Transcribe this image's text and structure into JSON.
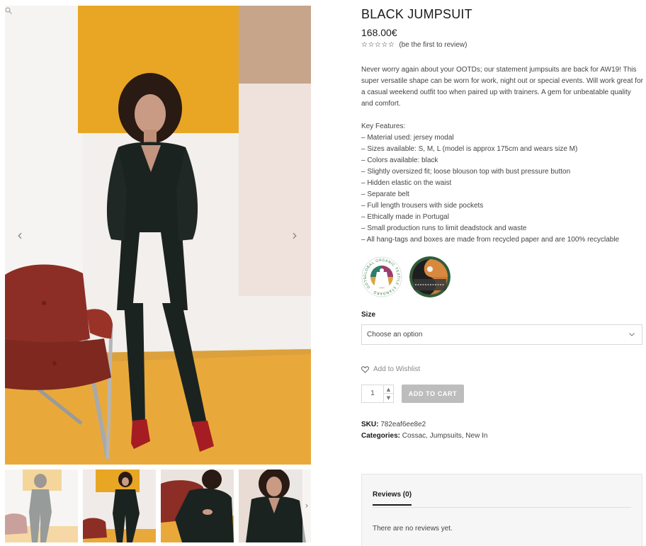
{
  "product": {
    "title": "BLACK JUMPSUIT",
    "price": "168.00€",
    "rating_stars": "☆☆☆☆☆",
    "review_link": "(be the first to review)",
    "description": "Never worry again about your OOTDs; our statement jumpsuits are back for AW19! This super versatile shape can be worn for work, night out or special events. Will work great for a casual weekend outfit too when paired up with trainers. A gem for unbeatable quality and comfort.",
    "features_heading": "Key Features:",
    "features": [
      "– Material used: jersey modal",
      "– Sizes available: S, M, L (model is approx 175cm and wears size M)",
      "– Colors available: black",
      "– Slightly oversized fit; loose blouson top with bust pressure button",
      "– Hidden elastic on the waist",
      "– Separate belt",
      "– Full length trousers with side pockets",
      "– Ethically made in Portugal",
      "– Small production runs to limit deadstock and waste",
      "– All hang-tags and boxes are made from recycled paper and are 100% recyclable"
    ]
  },
  "gallery": {
    "prev_icon": "chevron-left-icon",
    "next_icon": "chevron-right-icon",
    "prev_glyph": "‹",
    "next_glyph": "›",
    "thumb_next_glyph": "›",
    "thumbnail_count": 4,
    "active_thumbnail": 1
  },
  "badges": {
    "gots_text": "GLOBAL ORGANIC TEXTILE STANDARD · GOTS ·"
  },
  "form": {
    "size_label": "Size",
    "size_placeholder": "Choose an option",
    "wishlist_label": "Add to Wishlist",
    "quantity": "1",
    "qty_up_glyph": "▲",
    "qty_down_glyph": "▼",
    "add_to_cart": "ADD TO CART"
  },
  "meta": {
    "sku_label": "SKU:",
    "sku_value": "782eaf6ee8e2",
    "categories_label": "Categories:",
    "categories": [
      "Cossac",
      "Jumpsuits",
      "New In"
    ],
    "separator": ", "
  },
  "reviews": {
    "tab_label": "Reviews (0)",
    "empty_text": "There are no reviews yet."
  },
  "colors": {
    "mustard": "#e8a624",
    "floor": "#e9a93a",
    "chair_leather": "#8c2e25",
    "jumpsuit": "#1b2320",
    "boots": "#a51d22",
    "button_disabled": "#bdbdbd"
  }
}
